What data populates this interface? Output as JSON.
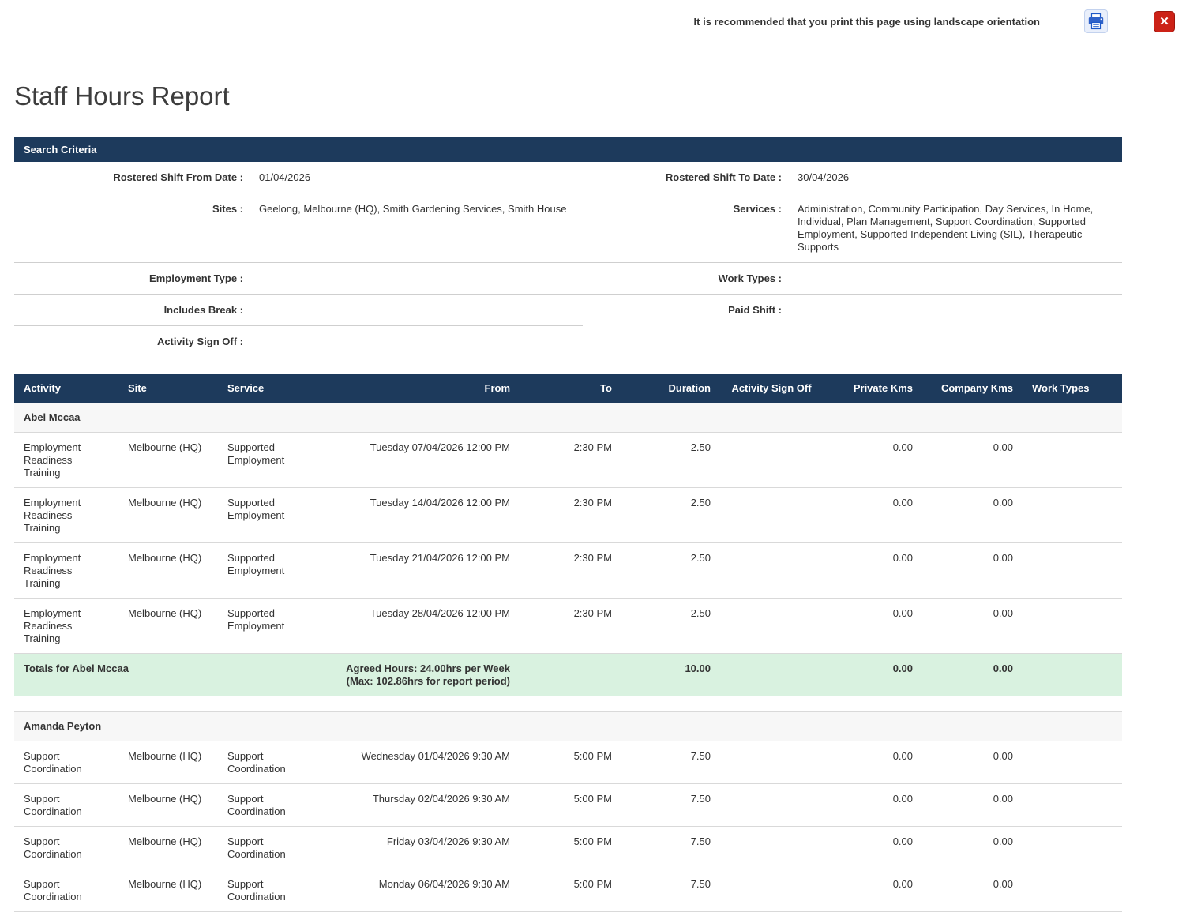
{
  "topbar": {
    "notice": "It is recommended that you print this page using landscape orientation"
  },
  "icons": {
    "print": "printer-icon",
    "close": "close-icon"
  },
  "page_title": "Staff Hours Report",
  "colors": {
    "header_bg": "#1d3a5c",
    "totals_bg": "#d9f2e0",
    "close_red": "#cc2217",
    "print_blue": "#2f62c9"
  },
  "search_criteria": {
    "header": "Search Criteria",
    "rows": [
      {
        "left_label": "Rostered Shift From Date :",
        "left_value": "01/04/2026",
        "right_label": "Rostered Shift To Date :",
        "right_value": "30/04/2026"
      },
      {
        "left_label": "Sites :",
        "left_value": "Geelong, Melbourne (HQ), Smith Gardening Services, Smith House",
        "right_label": "Services :",
        "right_value": "Administration, Community Participation, Day Services, In Home, Individual, Plan Management, Support Coordination, Supported Employment, Supported Independent Living (SIL), Therapeutic Supports"
      },
      {
        "left_label": "Employment Type :",
        "left_value": "",
        "right_label": "Work Types :",
        "right_value": ""
      },
      {
        "left_label": "Includes Break :",
        "left_value": "",
        "right_label": "Paid Shift :",
        "right_value": ""
      },
      {
        "left_label": "Activity Sign Off :",
        "left_value": "",
        "right_label": "",
        "right_value": ""
      }
    ]
  },
  "report_table": {
    "columns": [
      "Activity",
      "Site",
      "Service",
      "From",
      "To",
      "Duration",
      "Activity Sign Off",
      "Private Kms",
      "Company Kms",
      "Work Types"
    ],
    "groups": [
      {
        "name": "Abel Mccaa",
        "rows": [
          {
            "activity": "Employment Readiness Training",
            "site": "Melbourne (HQ)",
            "service": "Supported Employment",
            "from": "Tuesday 07/04/2026 12:00 PM",
            "to": "2:30 PM",
            "duration": "2.50",
            "sign_off": "",
            "private_kms": "0.00",
            "company_kms": "0.00",
            "work_types": ""
          },
          {
            "activity": "Employment Readiness Training",
            "site": "Melbourne (HQ)",
            "service": "Supported Employment",
            "from": "Tuesday 14/04/2026 12:00 PM",
            "to": "2:30 PM",
            "duration": "2.50",
            "sign_off": "",
            "private_kms": "0.00",
            "company_kms": "0.00",
            "work_types": ""
          },
          {
            "activity": "Employment Readiness Training",
            "site": "Melbourne (HQ)",
            "service": "Supported Employment",
            "from": "Tuesday 21/04/2026 12:00 PM",
            "to": "2:30 PM",
            "duration": "2.50",
            "sign_off": "",
            "private_kms": "0.00",
            "company_kms": "0.00",
            "work_types": ""
          },
          {
            "activity": "Employment Readiness Training",
            "site": "Melbourne (HQ)",
            "service": "Supported Employment",
            "from": "Tuesday 28/04/2026 12:00 PM",
            "to": "2:30 PM",
            "duration": "2.50",
            "sign_off": "",
            "private_kms": "0.00",
            "company_kms": "0.00",
            "work_types": ""
          }
        ],
        "totals": {
          "label": "Totals for Abel Mccaa",
          "agreed_line1": "Agreed Hours: 24.00hrs per Week",
          "agreed_line2": "(Max: 102.86hrs for report period)",
          "duration": "10.00",
          "private_kms": "0.00",
          "company_kms": "0.00"
        }
      },
      {
        "name": "Amanda Peyton",
        "rows": [
          {
            "activity": "Support Coordination",
            "site": "Melbourne (HQ)",
            "service": "Support Coordination",
            "from": "Wednesday 01/04/2026 9:30 AM",
            "to": "5:00 PM",
            "duration": "7.50",
            "sign_off": "",
            "private_kms": "0.00",
            "company_kms": "0.00",
            "work_types": ""
          },
          {
            "activity": "Support Coordination",
            "site": "Melbourne (HQ)",
            "service": "Support Coordination",
            "from": "Thursday 02/04/2026 9:30 AM",
            "to": "5:00 PM",
            "duration": "7.50",
            "sign_off": "",
            "private_kms": "0.00",
            "company_kms": "0.00",
            "work_types": ""
          },
          {
            "activity": "Support Coordination",
            "site": "Melbourne (HQ)",
            "service": "Support Coordination",
            "from": "Friday 03/04/2026 9:30 AM",
            "to": "5:00 PM",
            "duration": "7.50",
            "sign_off": "",
            "private_kms": "0.00",
            "company_kms": "0.00",
            "work_types": ""
          },
          {
            "activity": "Support Coordination",
            "site": "Melbourne (HQ)",
            "service": "Support Coordination",
            "from": "Monday 06/04/2026 9:30 AM",
            "to": "5:00 PM",
            "duration": "7.50",
            "sign_off": "",
            "private_kms": "0.00",
            "company_kms": "0.00",
            "work_types": ""
          }
        ]
      }
    ]
  }
}
